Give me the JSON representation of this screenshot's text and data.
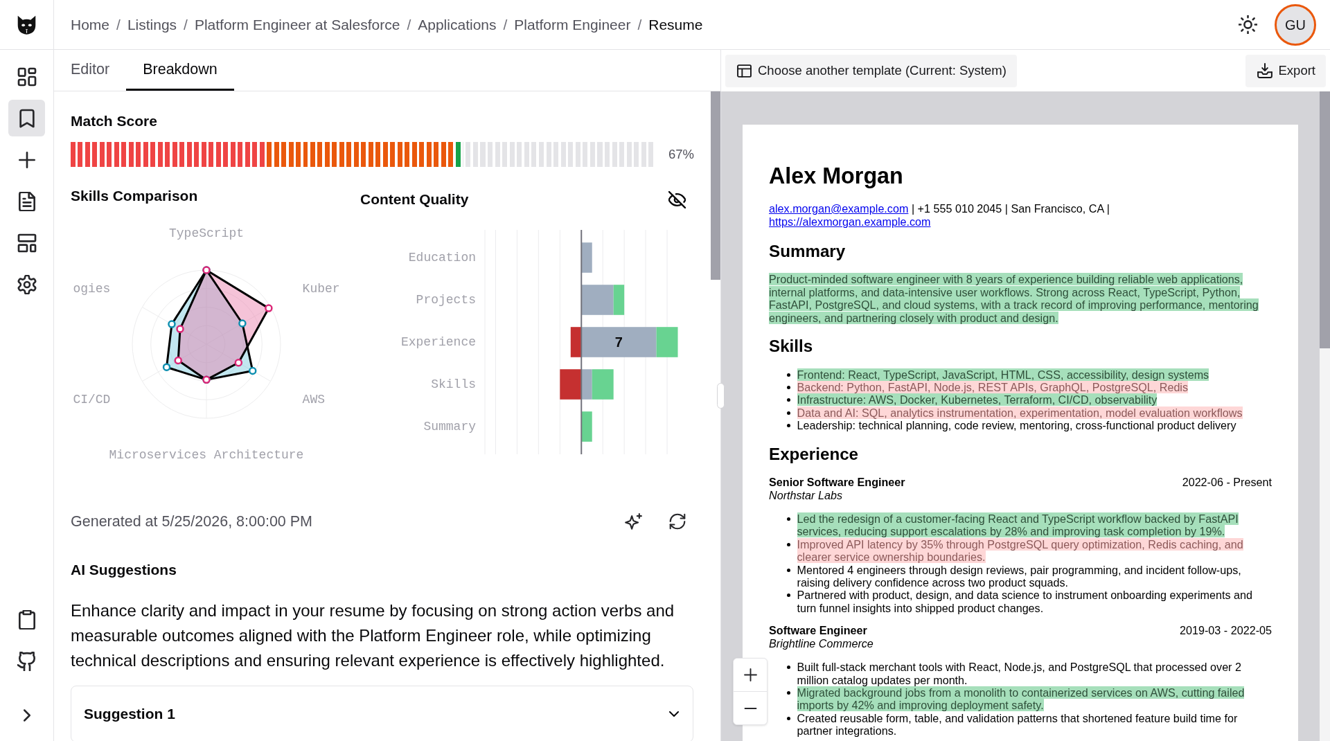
{
  "sidebar": {
    "items": [
      {
        "kind": "dashboard",
        "selected": false
      },
      {
        "kind": "bookmark",
        "selected": true
      },
      {
        "kind": "add",
        "selected": false
      },
      {
        "kind": "document",
        "selected": false
      },
      {
        "kind": "template",
        "selected": false
      },
      {
        "kind": "settings",
        "selected": false
      }
    ],
    "footer_items": [
      {
        "kind": "clipboard"
      },
      {
        "kind": "github"
      },
      {
        "kind": "expand"
      }
    ]
  },
  "breadcrumb": {
    "separator": "/",
    "items": [
      {
        "label": "Home",
        "current": false
      },
      {
        "label": "Listings",
        "current": false
      },
      {
        "label": "Platform Engineer at Salesforce",
        "current": false
      },
      {
        "label": "Applications",
        "current": false
      },
      {
        "label": "Platform Engineer",
        "current": false
      },
      {
        "label": "Resume",
        "current": true
      }
    ]
  },
  "header": {
    "avatar_initials": "GU"
  },
  "tabs": [
    {
      "label": "Editor",
      "selected": false
    },
    {
      "label": "Breakdown",
      "selected": true
    }
  ],
  "match_score": {
    "title": "Match Score",
    "level": 0.67,
    "reading": "67%"
  },
  "skills_comparison": {
    "title": "Skills Comparison",
    "axes": [
      "TypeScript",
      "Kuber",
      "AWS",
      "Microservices Architecture",
      "CI/CD",
      "ogies"
    ]
  },
  "content_quality": {
    "title": "Content Quality",
    "categories": [
      "Education",
      "Projects",
      "Experience",
      "Skills",
      "Summary"
    ],
    "bar_label": "7"
  },
  "generated_at": "Generated at 5/25/2026, 8:00:00 PM",
  "ai_suggestions": {
    "title": "AI Suggestions",
    "summary": "Enhance clarity and impact in your resume by focusing on strong action verbs and measurable outcomes aligned with the Platform Engineer role, while optimizing technical descriptions and ensuring relevant experience is effectively highlighted.",
    "items": [
      {
        "title": "Suggestion 1",
        "expanded": false
      }
    ]
  },
  "preview_toolbar": {
    "template_button": "Choose another template (Current: System)",
    "export_button": "Export"
  },
  "resume": {
    "name": "Alex Morgan",
    "contact": {
      "email": "alex.morgan@example.com",
      "details": "| +1 555 010 2045 | San Francisco, CA |",
      "website": "https://alexmorgan.example.com"
    },
    "summary": {
      "heading": "Summary",
      "text": "Product-minded software engineer with 8 years of experience building reliable web applications, internal platforms, and data-intensive user workflows. Strong across React, TypeScript, Python, FastAPI, PostgreSQL, and cloud systems, with a track record of improving performance, mentoring engineers, and partnering closely with product and design.",
      "kind": "matched"
    },
    "skills": {
      "heading": "Skills",
      "items": [
        {
          "text": "Frontend: React, TypeScript, JavaScript, HTML, CSS, accessibility, design systems",
          "kind": "matched"
        },
        {
          "text": "Backend: Python, FastAPI, Node.js, REST APIs, GraphQL, PostgreSQL, Redis",
          "kind": "missing"
        },
        {
          "text": "Infrastructure: AWS, Docker, Kubernetes, Terraform, CI/CD, observability",
          "kind": "matched"
        },
        {
          "text": "Data and AI: SQL, analytics instrumentation, experimentation, model evaluation workflows",
          "kind": "missing"
        },
        {
          "text": "Leadership: technical planning, code review, mentoring, cross-functional product delivery",
          "kind": "plain"
        }
      ]
    },
    "experience": {
      "heading": "Experience",
      "jobs": [
        {
          "title": "Senior Software Engineer",
          "dates": "2022-06 - Present",
          "company": "Northstar Labs",
          "bullets": [
            {
              "text": "Led the redesign of a customer-facing React and TypeScript workflow backed by FastAPI services, reducing support escalations by 28% and improving task completion by 19%.",
              "kind": "matched"
            },
            {
              "text": "Improved API latency by 35% through PostgreSQL query optimization, Redis caching, and clearer service ownership boundaries.",
              "kind": "missing"
            },
            {
              "text": "Mentored 4 engineers through design reviews, pair programming, and incident follow-ups, raising delivery confidence across two product squads.",
              "kind": "plain"
            },
            {
              "text": "Partnered with product, design, and data science to instrument onboarding experiments and turn funnel insights into shipped product changes.",
              "kind": "plain"
            }
          ]
        },
        {
          "title": "Software Engineer",
          "dates": "2019-03 - 2022-05",
          "company": "Brightline Commerce",
          "bullets": [
            {
              "text": "Built full-stack merchant tools with React, Node.js, and PostgreSQL that processed over 2 million catalog updates per month.",
              "kind": "plain"
            },
            {
              "text": "Migrated background jobs from a monolith to containerized services on AWS, cutting failed imports by 42% and improving deployment safety.",
              "kind": "matched"
            },
            {
              "text": "Created reusable form, table, and validation patterns that shortened feature build time for partner integrations.",
              "kind": "plain"
            }
          ]
        }
      ]
    }
  }
}
